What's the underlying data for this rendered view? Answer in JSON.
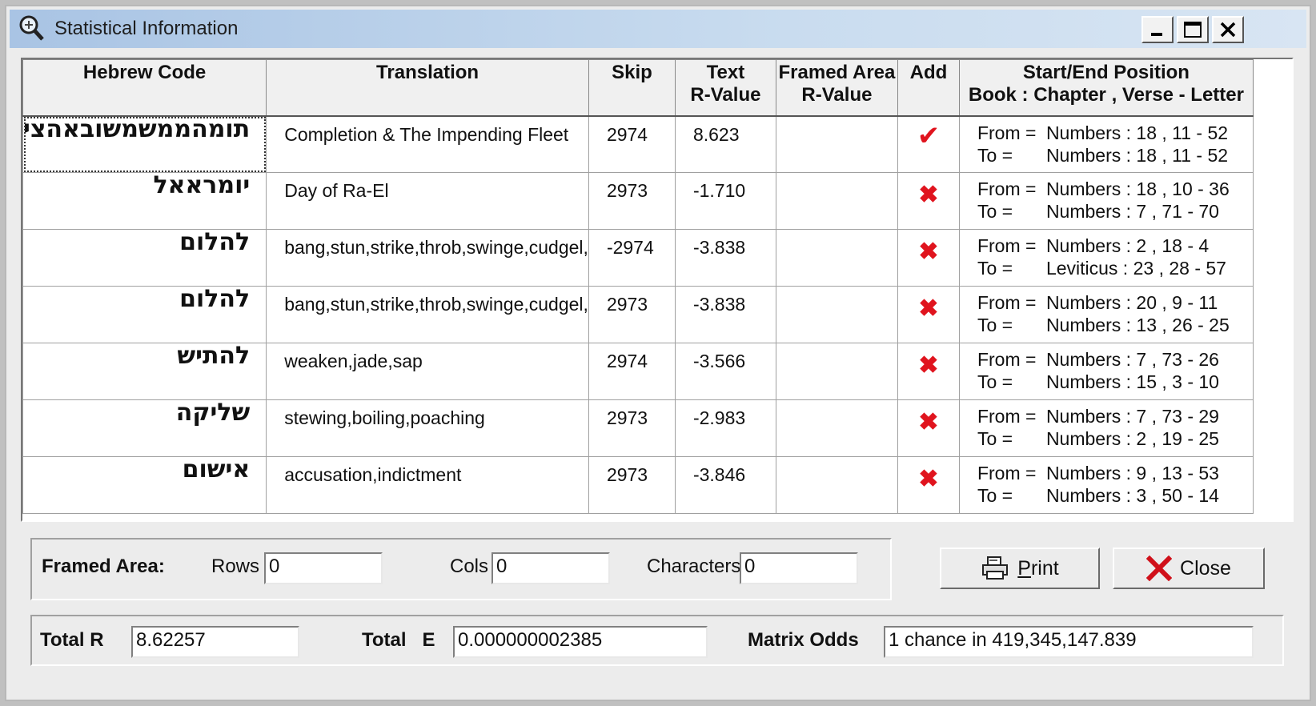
{
  "window": {
    "title": "Statistical Information"
  },
  "title_buttons": {
    "minimize": "_",
    "maximize": "□",
    "close": "✕"
  },
  "grid": {
    "headers": {
      "hebrew": "Hebrew Code",
      "translation": "Translation",
      "skip": "Skip",
      "text_r_1": "Text",
      "text_r_2": "R-Value",
      "framed_1": "Framed Area",
      "framed_2": "R-Value",
      "add": "Add",
      "pos_1": "Start/End Position",
      "pos_2": "Book : Chapter , Verse - Letter"
    },
    "rows": [
      {
        "hebrew": "תומהממשמשובאהצי",
        "translation": "Completion & The Impending Fleet",
        "skip": "2974",
        "text_r": "8.623",
        "framed_r": "",
        "added": true,
        "from_label": "From =",
        "from": "Numbers : 18 , 11 - 52",
        "to_label": "To =",
        "to": "Numbers : 18 , 11 - 52"
      },
      {
        "hebrew": "יומראאל",
        "translation": "Day of Ra-El",
        "skip": "2973",
        "text_r": "-1.710",
        "framed_r": "",
        "added": false,
        "from_label": "From =",
        "from": "Numbers : 18 , 10 - 36",
        "to_label": "To =",
        "to": "Numbers : 7 , 71 - 70"
      },
      {
        "hebrew": "להלום",
        "translation": "bang,stun,strike,throb,swinge,cudgel,",
        "skip": "-2974",
        "text_r": "-3.838",
        "framed_r": "",
        "added": false,
        "from_label": "From =",
        "from": "Numbers : 2 , 18 - 4",
        "to_label": "To =",
        "to": "Leviticus : 23 , 28 - 57"
      },
      {
        "hebrew": "להלום",
        "translation": "bang,stun,strike,throb,swinge,cudgel,",
        "skip": "2973",
        "text_r": "-3.838",
        "framed_r": "",
        "added": false,
        "from_label": "From =",
        "from": "Numbers : 20 , 9 - 11",
        "to_label": "To =",
        "to": "Numbers : 13 , 26 - 25"
      },
      {
        "hebrew": "להתיש",
        "translation": "weaken,jade,sap",
        "skip": "2974",
        "text_r": "-3.566",
        "framed_r": "",
        "added": false,
        "from_label": "From =",
        "from": "Numbers : 7 , 73 - 26",
        "to_label": "To =",
        "to": "Numbers : 15 , 3 - 10"
      },
      {
        "hebrew": "שליקה",
        "translation": "stewing,boiling,poaching",
        "skip": "2973",
        "text_r": "-2.983",
        "framed_r": "",
        "added": false,
        "from_label": "From =",
        "from": "Numbers : 7 , 73 - 29",
        "to_label": "To =",
        "to": "Numbers : 2 , 19 - 25"
      },
      {
        "hebrew": "אישום",
        "translation": "accusation,indictment",
        "skip": "2973",
        "text_r": "-3.846",
        "framed_r": "",
        "added": false,
        "from_label": "From =",
        "from": "Numbers : 9 , 13 - 53",
        "to_label": "To =",
        "to": "Numbers : 3 , 50 - 14"
      }
    ]
  },
  "framed_area": {
    "label": "Framed Area:",
    "rows_label": "Rows",
    "rows_value": "0",
    "cols_label": "Cols",
    "cols_value": "0",
    "chars_label": "Characters",
    "chars_value": "0"
  },
  "buttons": {
    "print_first": "P",
    "print_rest": "rint",
    "close": "Close"
  },
  "totals": {
    "total_r_label": "Total R",
    "total_r_value": "8.62257",
    "total_e_label": "Total   E",
    "total_e_value": "0.000000002385",
    "odds_label": "Matrix Odds",
    "odds_value": "1 chance in 419,345,147.839"
  },
  "colors": {
    "accent_red": "#e0141e",
    "titlebar": "#b9d1ea"
  }
}
